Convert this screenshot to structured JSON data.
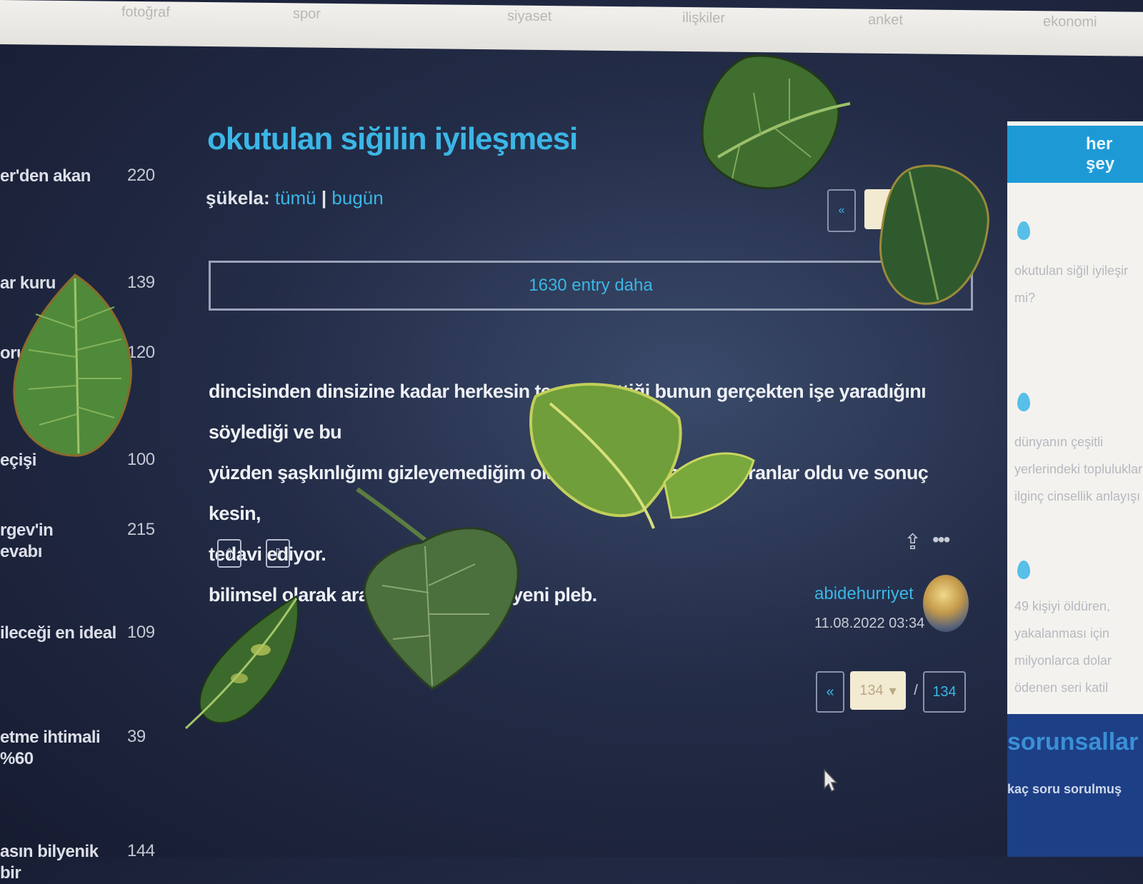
{
  "topnav": [
    "fotoğraf",
    "spor",
    "siyaset",
    "ilişkiler",
    "anket",
    "ekonomi"
  ],
  "left_list": [
    {
      "title": "er'den akan",
      "count": "220"
    },
    {
      "title": "ar kuru",
      "count": "139"
    },
    {
      "title": "oru",
      "count": "120"
    },
    {
      "title": "eçişi",
      "count": "100"
    },
    {
      "title": "rgev'in\nevabı",
      "count": "215"
    },
    {
      "title": "ileceği en ideal",
      "count": "109"
    },
    {
      "title": "etme ihtimali %60",
      "count": "39"
    },
    {
      "title": "asın bilyenik bir",
      "count": "144"
    }
  ],
  "main": {
    "title": "okutulan siğilin iyileşmesi",
    "sukela_label": "şükela:",
    "sukela_all": "tümü",
    "sukela_today": "bugün",
    "more_entries": "1630 entry daha",
    "entry_lines": [
      "dincisinden dinsizine kadar herkesin tecrübe ettiği bunun gerçekten işe yaradığını söylediği ve bu",
      "yüzden şaşkınlığımı gizleyemediğim olay. bizzat ailemde yaptıranlar oldu ve sonuç kesin,",
      "tedavi ediyor.",
      "bilimsel olarak araştırılmalı bence. yeni pleb."
    ],
    "author": "abidehurriyet",
    "date": "11.08.2022 03:34",
    "pager": {
      "prev": "«",
      "current": "134",
      "separator": "/",
      "last": "134"
    },
    "top_nav_prev": "«"
  },
  "right": {
    "header": "her şey",
    "items": [
      {
        "label": "okutulan siğil iyileşir mi?"
      },
      {
        "label": "dünyanın çeşitli yerlerindeki topluluklar ilginç cinsellik anlayışı"
      },
      {
        "label": "49 kişiyi öldüren, yakalanması için milyonlarca dolar ödenen seri katil"
      }
    ],
    "footer_title": "sorunsallar",
    "footer_sub": "kaç soru sorulmuş"
  }
}
